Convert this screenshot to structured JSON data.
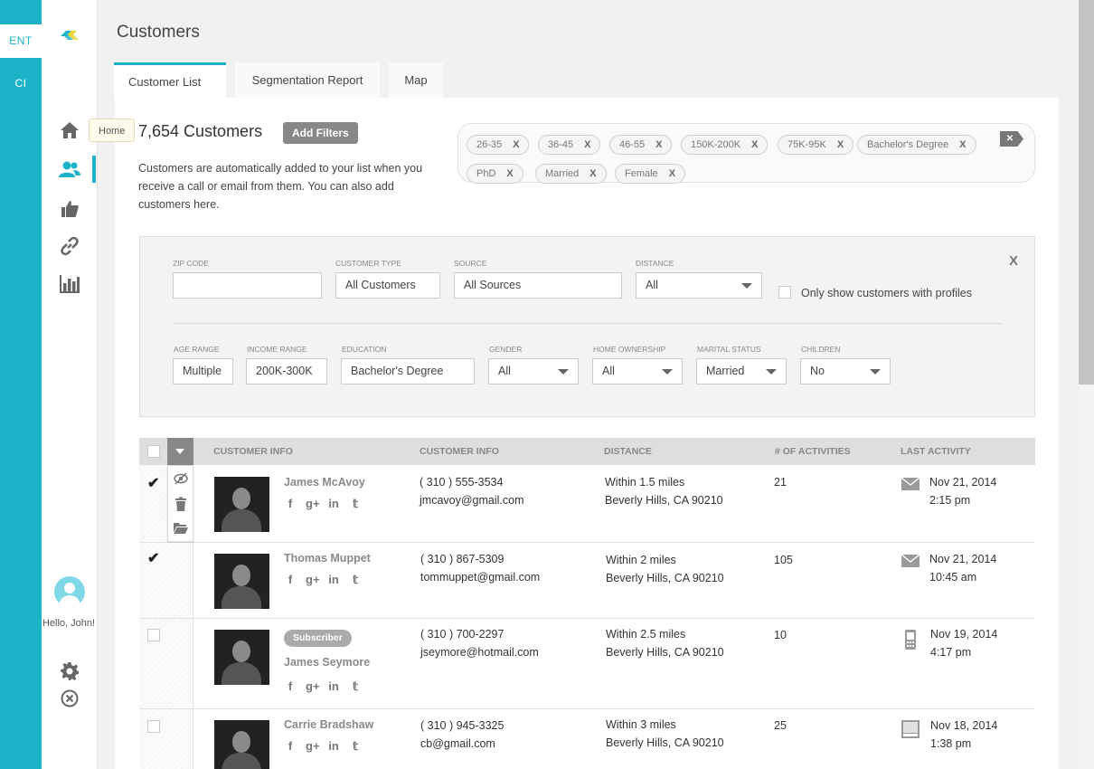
{
  "modes": {
    "ent": "ENT",
    "ci": "CI"
  },
  "tooltip": "Home",
  "user": {
    "greeting": "Hello, John!"
  },
  "page_title": "Customers",
  "tabs": [
    {
      "label": "Customer List",
      "active": true
    },
    {
      "label": "Segmentation Report",
      "active": false
    },
    {
      "label": "Map",
      "active": false
    }
  ],
  "summary": {
    "count": "7,654 Customers",
    "add_filters": "Add Filters",
    "description": "Customers are automatically added to your list when you receive a call or email from them. You can also add customers here."
  },
  "chips": [
    {
      "label": "26-35",
      "x": "X"
    },
    {
      "label": "36-45",
      "x": "X"
    },
    {
      "label": "46-55",
      "x": "X"
    },
    {
      "label": "150K-200K",
      "x": "X"
    },
    {
      "label": "75K-95K",
      "x": "X"
    },
    {
      "label": "Bachelor's Degree",
      "x": "X"
    },
    {
      "label": "PhD",
      "x": "X"
    },
    {
      "label": "Married",
      "x": "X"
    },
    {
      "label": "Female",
      "x": "X"
    }
  ],
  "filters": {
    "close": "X",
    "zip": {
      "label": "ZIP CODE",
      "value": ""
    },
    "customer_type": {
      "label": "CUSTOMER TYPE",
      "value": "All Customers"
    },
    "source": {
      "label": "SOURCE",
      "value": "All Sources"
    },
    "distance": {
      "label": "DISTANCE",
      "value": "All"
    },
    "profiles_only": {
      "label": "Only show customers with profiles",
      "checked": false
    },
    "age_range": {
      "label": "AGE RANGE",
      "value": "Multiple"
    },
    "income_range": {
      "label": "INCOME RANGE",
      "value": "200K-300K"
    },
    "education": {
      "label": "EDUCATION",
      "value": "Bachelor's Degree"
    },
    "gender": {
      "label": "GENDER",
      "value": "All"
    },
    "home_ownership": {
      "label": "HOME OWNERSHIP",
      "value": "All"
    },
    "marital_status": {
      "label": "MARITAL STATUS",
      "value": "Married"
    },
    "children": {
      "label": "CHILDREN",
      "value": "No"
    }
  },
  "table": {
    "headers": [
      "CUSTOMER INFO",
      "CUSTOMER INFO",
      "DISTANCE",
      "# OF ACTIVITIES",
      "LAST ACTIVITY"
    ],
    "rows": [
      {
        "name": "James McAvoy",
        "badge": "",
        "phone": "( 310 ) 555-3534",
        "email": "jmcavoy@gmail.com",
        "distance": "Within 1.5 miles",
        "location": "Beverly Hills, CA 90210",
        "activities": "21",
        "last_date": "Nov 21, 2014",
        "last_time": "2:15 pm",
        "activity_icon": "mail-icon",
        "checked": true
      },
      {
        "name": "Thomas Muppet",
        "badge": "",
        "phone": "( 310 ) 867-5309",
        "email": "tommuppet@gmail.com",
        "distance": "Within 2 miles",
        "location": "Beverly Hills, CA 90210",
        "activities": "105",
        "last_date": "Nov 21, 2014",
        "last_time": "10:45 am",
        "activity_icon": "mail-icon",
        "checked": true
      },
      {
        "name": "James Seymore",
        "badge": "Subscriber",
        "phone": "( 310 ) 700-2297",
        "email": "jseymore@hotmail.com",
        "distance": "Within 2.5 miles",
        "location": "Beverly Hills, CA 90210",
        "activities": "10",
        "last_date": "Nov 19, 2014",
        "last_time": "4:17 pm",
        "activity_icon": "phone-icon",
        "checked": false
      },
      {
        "name": "Carrie Bradshaw",
        "badge": "",
        "phone": "( 310 ) 945-3325",
        "email": "cb@gmail.com",
        "distance": "Within 3 miles",
        "location": "Beverly Hills, CA 90210",
        "activities": "25",
        "last_date": "Nov 18, 2014",
        "last_time": "1:38 pm",
        "activity_icon": "web-icon",
        "checked": false
      }
    ]
  },
  "colors": {
    "accent": "#1cb3c8"
  }
}
